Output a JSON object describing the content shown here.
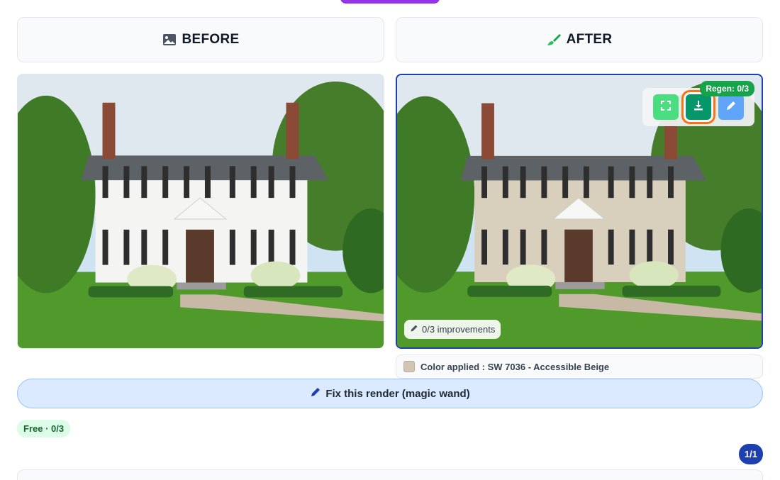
{
  "headers": {
    "before": "BEFORE",
    "after": "AFTER"
  },
  "after_panel": {
    "regen_badge": "Regen: 0/3",
    "improvements": "0/3 improvements"
  },
  "color_applied": {
    "text": "Color applied : SW 7036 - Accessible Beige",
    "swatch_color": "#d1c6b4"
  },
  "fix_button": {
    "label": "Fix this render (magic wand)"
  },
  "plan_badge": "Free · 0/3",
  "page_counter": "1/1",
  "colors": {
    "accent_blue": "#1e40af",
    "green_button": "#059669",
    "highlight_orange": "#f97316"
  },
  "icons": [
    "image-icon",
    "brush-icon",
    "fullscreen-icon",
    "download-icon",
    "pencil-icon"
  ]
}
